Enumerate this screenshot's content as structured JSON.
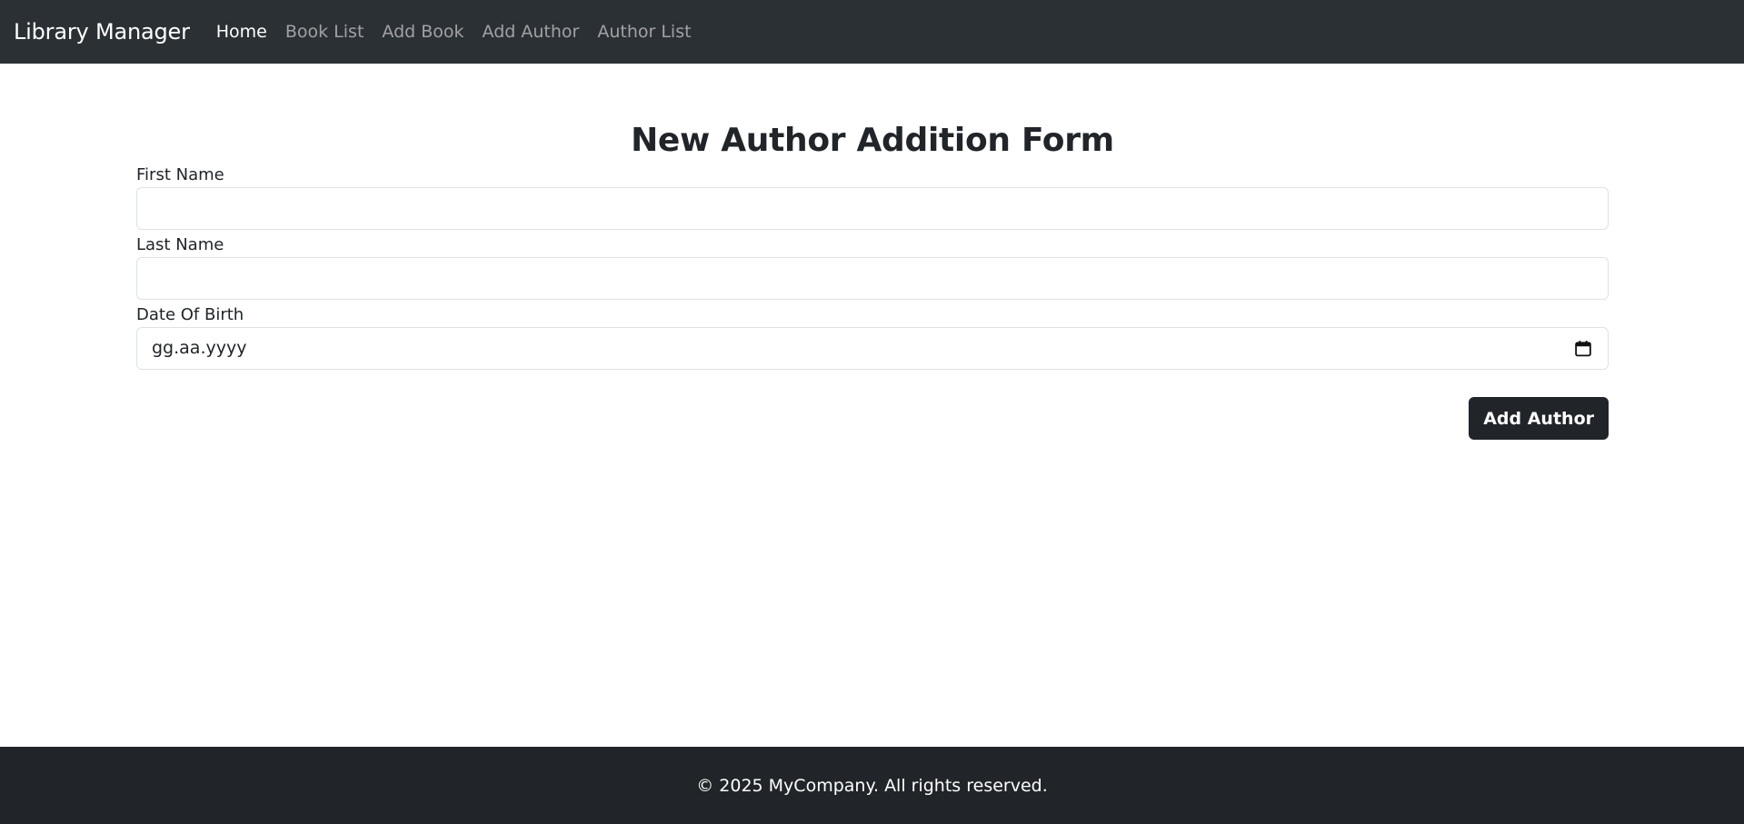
{
  "navbar": {
    "brand": "Library Manager",
    "links": [
      {
        "label": "Home",
        "active": true
      },
      {
        "label": "Book List",
        "active": false
      },
      {
        "label": "Add Book",
        "active": false
      },
      {
        "label": "Add Author",
        "active": false
      },
      {
        "label": "Author List",
        "active": false
      }
    ]
  },
  "form": {
    "title": "New Author Addition Form",
    "fields": {
      "first_name": {
        "label": "First Name",
        "value": ""
      },
      "last_name": {
        "label": "Last Name",
        "value": ""
      },
      "date_of_birth": {
        "label": "Date Of Birth",
        "value": "gg.aa.yyyy",
        "icon": "calendar-icon"
      }
    },
    "submit_label": "Add Author"
  },
  "footer": {
    "text": "© 2025 MyCompany. All rights reserved."
  },
  "colors": {
    "navbar_bg": "#2b3035",
    "footer_bg": "#212529",
    "button_bg": "#212529",
    "input_border": "#dee2e6"
  }
}
